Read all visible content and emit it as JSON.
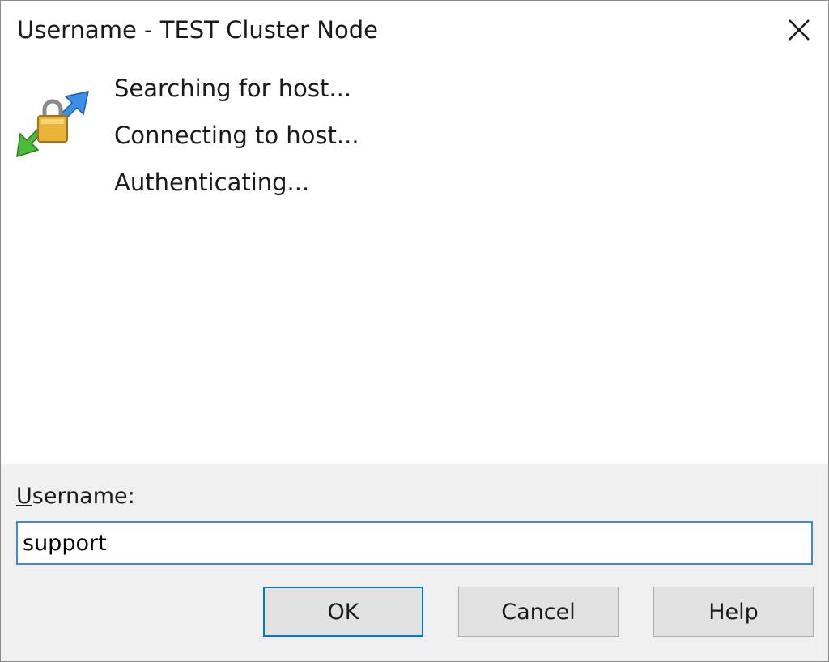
{
  "window": {
    "title": "Username - TEST Cluster Node"
  },
  "status": {
    "lines": [
      "Searching for host...",
      "Connecting to host...",
      "Authenticating..."
    ]
  },
  "form": {
    "label_accel": "U",
    "label_rest": "sername:",
    "username_value": "support"
  },
  "buttons": {
    "ok": "OK",
    "cancel": "Cancel",
    "help": "Help"
  },
  "icons": {
    "close": "close-icon",
    "connection": "secure-connection-icon"
  },
  "colors": {
    "focus_border": "#3f8ad8",
    "default_button_border": "#0078d7",
    "footer_bg": "#f0f0f0"
  }
}
